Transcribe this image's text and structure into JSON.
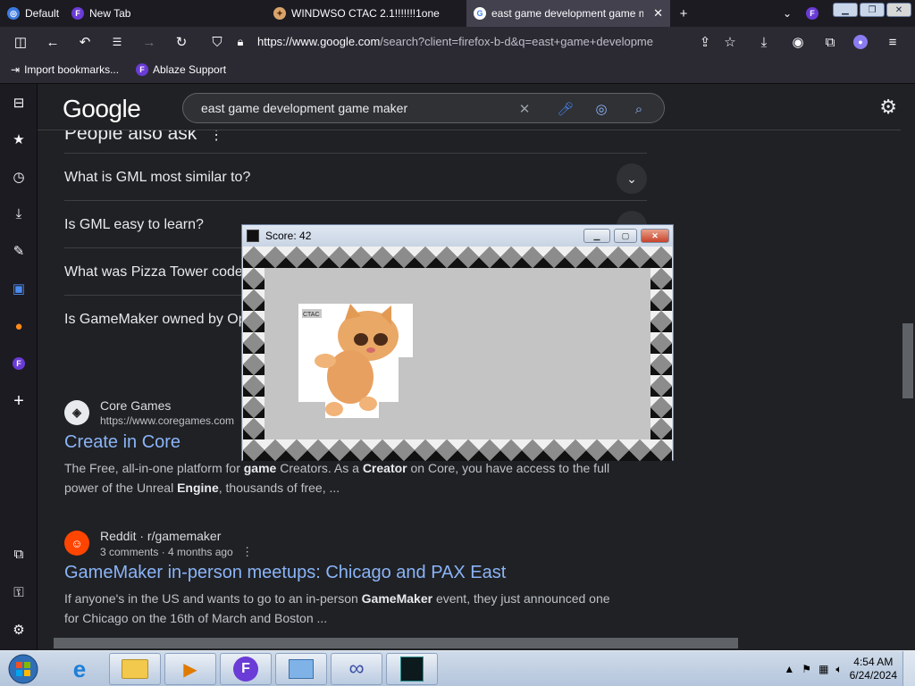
{
  "tabs": [
    {
      "label": "Default"
    },
    {
      "label": "New Tab"
    },
    {
      "label": "WINDWSO CTAC 2.1!!!!!!!1one"
    },
    {
      "label": "east game development game m"
    }
  ],
  "url": {
    "host": "https://www.google.com",
    "rest": "/search?client=firefox-b-d&q=east+game+developme"
  },
  "bookmarks": [
    {
      "label": "Import bookmarks..."
    },
    {
      "label": "Ablaze Support"
    }
  ],
  "google": {
    "logo": "Google",
    "query": "east game development game maker"
  },
  "paa": {
    "title": "People also ask",
    "questions": [
      "What is GML most similar to?",
      "Is GML easy to learn?",
      "What was Pizza Tower code",
      "Is GameMaker owned by Op"
    ]
  },
  "results": [
    {
      "site": "Core Games",
      "sub": "https://www.coregames.com",
      "title": "Create in Core",
      "snippet_html": "The Free, all-in-one platform for <b>game</b> Creators. As a <b>Creator</b> on Core, you have access to the full power of the Unreal <b>Engine</b>, thousands of free, ..."
    },
    {
      "site": "Reddit · r/gamemaker",
      "sub": "3 comments · 4 months ago",
      "title": "GameMaker in-person meetups: Chicago and PAX East",
      "snippet_html": "If anyone's in the US and wants to go to an in-person <b>GameMaker</b> event, they just announced one for Chicago on the 16th of March and Boston ..."
    }
  ],
  "game": {
    "title": "Score: 42",
    "sprite_label": "CTAC"
  },
  "clock": {
    "time": "4:54 AM",
    "date": "6/24/2024"
  },
  "colors": {
    "accent": "#8ab4f8",
    "bg": "#202124",
    "chrome": "#2b2a33"
  }
}
